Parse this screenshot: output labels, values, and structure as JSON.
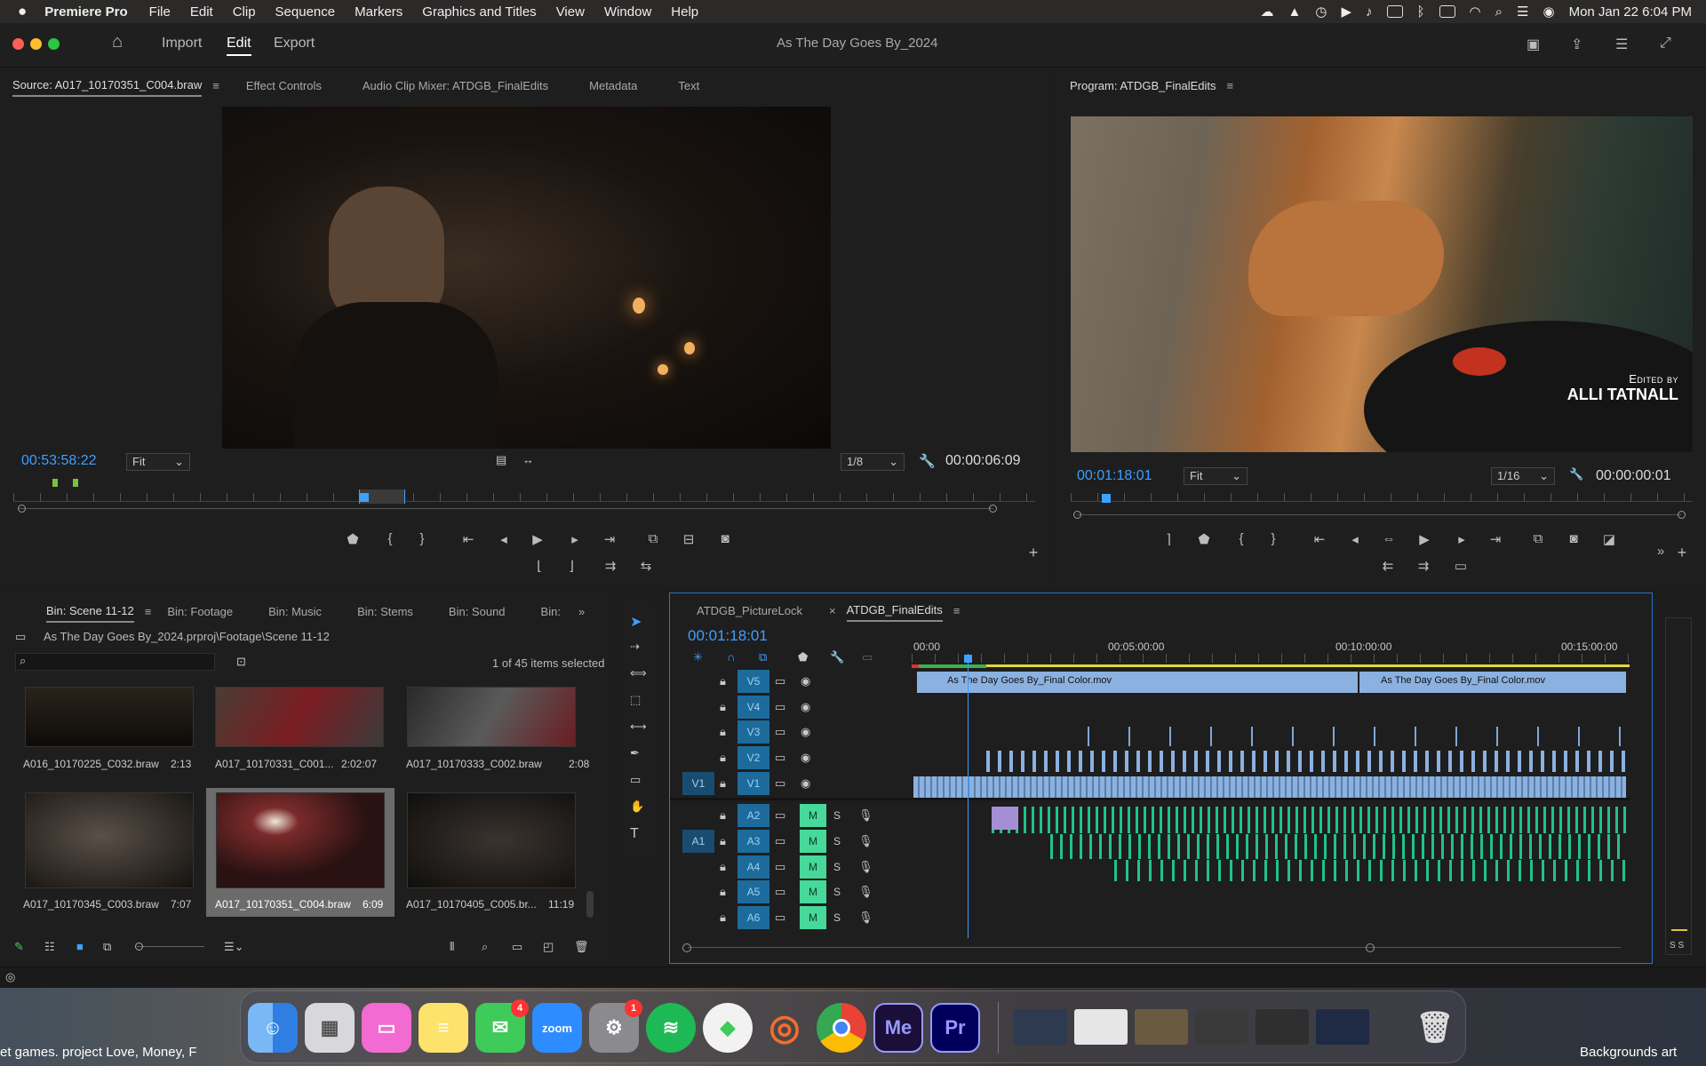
{
  "menubar": {
    "app": "Premiere Pro",
    "items": [
      "File",
      "Edit",
      "Clip",
      "Sequence",
      "Markers",
      "Graphics and Titles",
      "View",
      "Window",
      "Help"
    ],
    "clock": "Mon Jan 22  6:04 PM"
  },
  "titlebar": {
    "title": "As The Day Goes By_2024",
    "workspaces": [
      "Import",
      "Edit",
      "Export"
    ]
  },
  "source": {
    "tabs": [
      "Source: A017_10170351_C004.braw",
      "Effect Controls",
      "Audio Clip Mixer: ATDGB_FinalEdits",
      "Metadata",
      "Text"
    ],
    "timecode": "00:53:58:22",
    "fit": "Fit",
    "resolution": "1/8",
    "duration": "00:00:06:09"
  },
  "program": {
    "tab": "Program: ATDGB_FinalEdits",
    "timecode": "00:01:18:01",
    "fit": "Fit",
    "resolution": "1/16",
    "duration": "00:00:00:01",
    "overlay_small": "Edited by",
    "overlay_big": "ALLI TATNALL"
  },
  "bins": {
    "tabs": [
      "Bin: Scene 11-12",
      "Bin: Footage",
      "Bin: Music",
      "Bin: Stems",
      "Bin: Sound",
      "Bin:"
    ],
    "path": "As The Day Goes By_2024.prproj\\Footage\\Scene 11-12",
    "selection": "1 of 45 items selected",
    "items": [
      {
        "name": "A016_10170225_C032.braw",
        "dur": "2:13"
      },
      {
        "name": "A017_10170331_C001...",
        "dur": "2:02:07"
      },
      {
        "name": "A017_10170333_C002.braw",
        "dur": "2:08"
      },
      {
        "name": "A017_10170345_C003.braw",
        "dur": "7:07"
      },
      {
        "name": "A017_10170351_C004.braw",
        "dur": "6:09"
      },
      {
        "name": "A017_10170405_C005.br...",
        "dur": "11:19"
      }
    ]
  },
  "timeline": {
    "tabs": [
      "ATDGB_PictureLock",
      "ATDGB_FinalEdits"
    ],
    "timecode": "00:01:18:01",
    "ruler": [
      "00:00",
      "00:05:00:00",
      "00:10:00:00",
      "00:15:00:00"
    ],
    "video_tracks": [
      "V5",
      "V4",
      "V3",
      "V2",
      "V1"
    ],
    "audio_tracks": [
      "A2",
      "A3",
      "A4",
      "A5",
      "A6"
    ],
    "source_v": "V1",
    "source_a": "A1",
    "clip1": "As The Day Goes By_Final Color.mov",
    "clip2": "As The Day Goes By_Final Color.mov",
    "m": "M",
    "s": "S",
    "meter_labels": "S S"
  },
  "dock": {
    "apps": [
      "Finder",
      "Launchpad",
      "CleanMyMac",
      "Notes",
      "Messages",
      "Zoom",
      "System Settings",
      "Spotify",
      "The Sims",
      "Origin",
      "Chrome",
      "Media Encoder",
      "Premiere Pro"
    ],
    "zoom_label": "zoom",
    "me_label": "Me",
    "pr_label": "Pr",
    "messages_badge": "4",
    "settings_badge": "1"
  },
  "desktop": {
    "left_text": "et games.  project Love, Money, F",
    "right_text": "Backgrounds art"
  }
}
